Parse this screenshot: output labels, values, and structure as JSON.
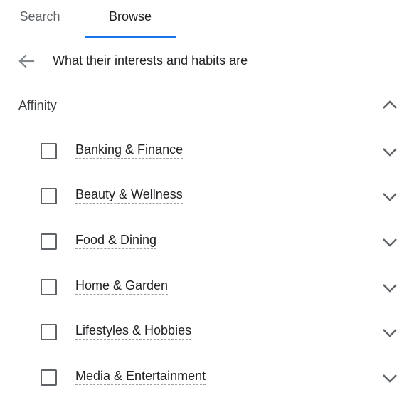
{
  "tabs": [
    {
      "label": "Search",
      "active": false
    },
    {
      "label": "Browse",
      "active": true
    }
  ],
  "colors": {
    "accent": "#1a73e8",
    "text": "#202124",
    "muted": "#5f6368",
    "divider": "#e0e0e0"
  },
  "breadcrumb": {
    "back_icon": "arrow-back-icon",
    "title": "What their interests and habits are"
  },
  "section": {
    "title": "Affinity",
    "expanded": true,
    "toggle_icon": "chevron-up-icon"
  },
  "items": [
    {
      "label": "Banking & Finance",
      "checked": false,
      "expand_icon": "chevron-down-icon"
    },
    {
      "label": "Beauty & Wellness",
      "checked": false,
      "expand_icon": "chevron-down-icon"
    },
    {
      "label": "Food & Dining",
      "checked": false,
      "expand_icon": "chevron-down-icon"
    },
    {
      "label": "Home & Garden",
      "checked": false,
      "expand_icon": "chevron-down-icon"
    },
    {
      "label": "Lifestyles & Hobbies",
      "checked": false,
      "expand_icon": "chevron-down-icon"
    },
    {
      "label": "Media & Entertainment",
      "checked": false,
      "expand_icon": "chevron-down-icon"
    }
  ]
}
